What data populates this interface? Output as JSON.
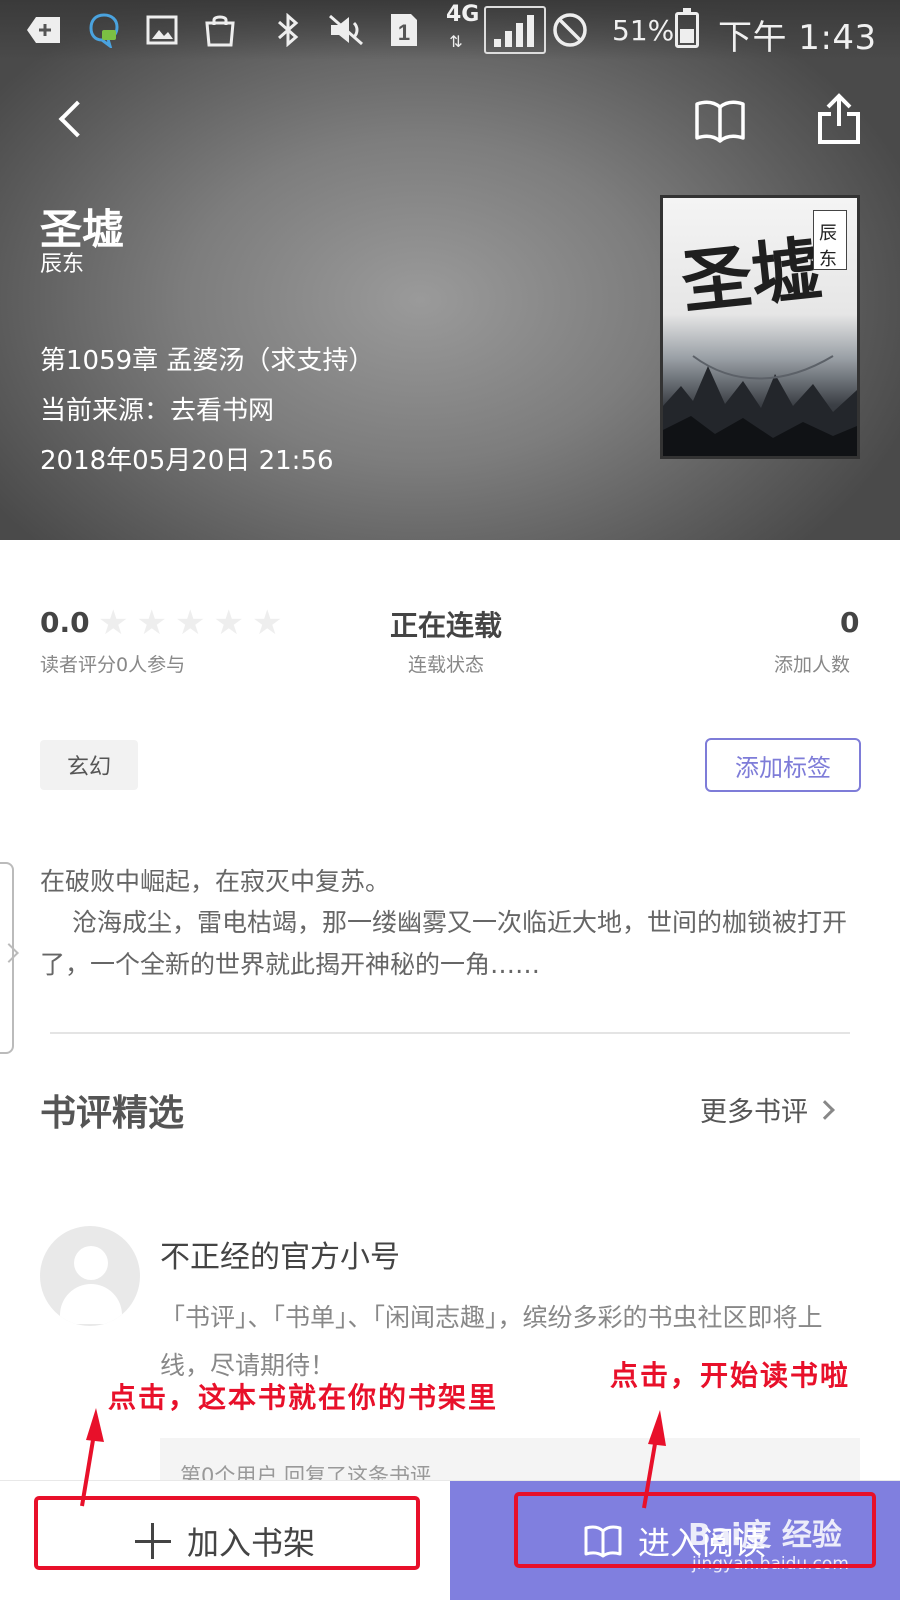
{
  "status_bar": {
    "battery": "51%",
    "time": "下午 1:43",
    "network": "4G",
    "sim_slot": "1",
    "icons": [
      "add-box-icon",
      "chat-bubble-icon",
      "image-icon",
      "shopping-bag-icon",
      "bluetooth-icon",
      "mute-icon",
      "sim-icon",
      "signal-icon",
      "do-not-disturb-icon",
      "battery-icon"
    ]
  },
  "nav": {
    "icons": [
      "back-arrow-icon",
      "read-book-icon",
      "share-icon"
    ]
  },
  "book": {
    "title": "圣墟",
    "author": "辰东",
    "latest_chapter": "第1059章 孟婆汤（求支持）",
    "source": "当前来源：去看书网",
    "updated": "2018年05月20日 21:56",
    "cover_title": "圣墟",
    "cover_seal": "辰东"
  },
  "stats": {
    "rating": "0.0",
    "stars_filled": 0,
    "stars_total": 5,
    "rating_caption": "读者评分0人参与",
    "serial_status": "正在连载",
    "serial_caption": "连载状态",
    "added_count": "0",
    "added_caption": "添加人数"
  },
  "tags": {
    "genre": "玄幻",
    "add_label": "添加标签"
  },
  "description": {
    "line1": "在破败中崛起，在寂灭中复苏。",
    "line2": "沧海成尘，雷电枯竭，那一缕幽雾又一次临近大地，世间的枷锁被打开了，一个全新的世界就此揭开神秘的一角……"
  },
  "reviews": {
    "title": "书评精选",
    "more": "更多书评",
    "items": [
      {
        "user": "不正经的官方小号",
        "text": "「书评」、「书单」、「闲闻志趣」，缤纷多彩的书虫社区即将上线，尽请期待！",
        "reply": "第0个用户 回复了这条书评"
      }
    ]
  },
  "bottom": {
    "add_shelf": "加入书架",
    "start_read": "进入阅读"
  },
  "annotations": {
    "left": "点击，这本书就在你的书架里",
    "right": "点击，开始读书啦"
  },
  "watermark": {
    "main": "Bai度 经验",
    "sub": "jingyan.baidu.com"
  },
  "colors": {
    "accent": "#807fdf",
    "annotation": "#e8102a"
  }
}
